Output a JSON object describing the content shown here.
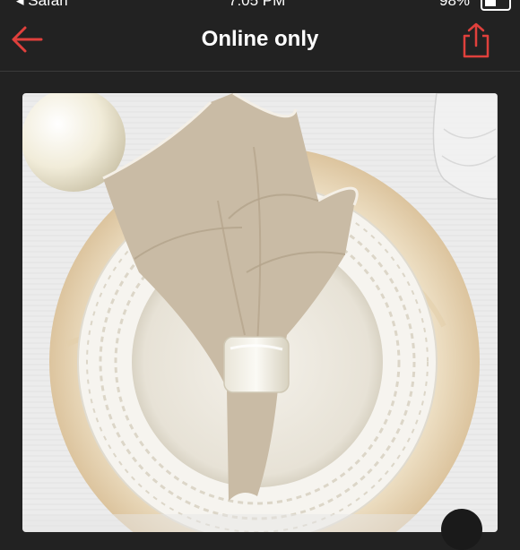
{
  "status_bar": {
    "carrier": "◂ Safari",
    "time": "7:05 PM",
    "battery_text": "98%"
  },
  "nav": {
    "title": "Online only",
    "back_icon": "arrow-left-icon",
    "share_icon": "share-icon"
  },
  "colors": {
    "accent": "#e0403c",
    "background": "#222222",
    "title": "#ffffff"
  },
  "listing": {
    "image_subject": "linen napkin in napkin ring on white plate with capiz charger"
  }
}
